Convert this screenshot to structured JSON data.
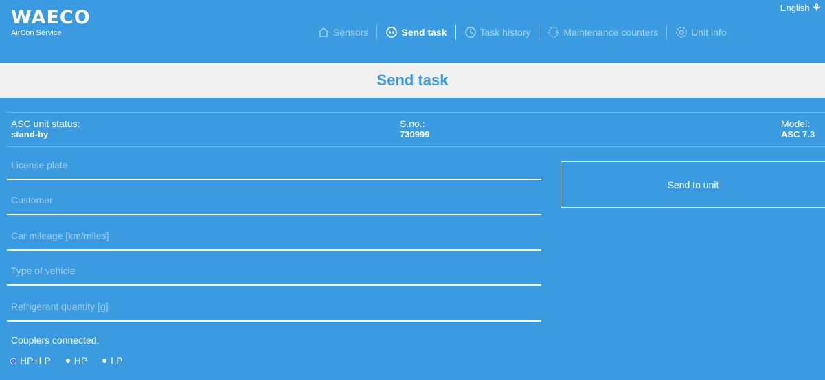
{
  "header": {
    "logo": "WAECO",
    "logo_sub": "AirCon Service",
    "language": "English"
  },
  "nav": {
    "sensors": "Sensors",
    "send_task": "Send task",
    "task_history": "Task history",
    "maintenance_counters": "Maintenance counters",
    "unit_info": "Unit info"
  },
  "page_title": "Send task",
  "status": {
    "asc_label": "ASC unit status:",
    "asc_value": "stand-by",
    "sno_label": "S.no.:",
    "sno_value": "730999",
    "model_label": "Model:",
    "model_value": "ASC 7.3"
  },
  "form": {
    "license_plate": "License plate",
    "customer": "Customer",
    "car_mileage": "Car mileage [km/miles]",
    "type_of_vehicle": "Type of vehicle",
    "refrigerant_quantity": "Refrigerant quantity [g]"
  },
  "send_button": "Send to unit",
  "couplers": {
    "label": "Couplers connected:",
    "options": [
      "HP+LP",
      "HP",
      "LP"
    ],
    "selected": "HP+LP"
  },
  "colors": {
    "background": "#3a9be0",
    "title_bar": "#f1f1f1",
    "accent_text": "#3a9be0"
  }
}
